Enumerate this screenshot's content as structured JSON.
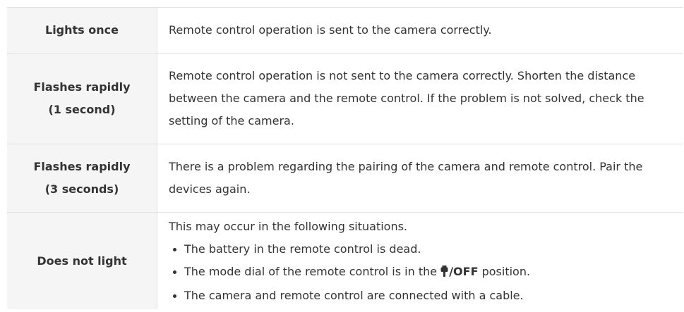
{
  "rows": [
    {
      "status": "Lights once",
      "description": "Remote control operation is sent to the camera correctly."
    },
    {
      "status": "Flashes rapidly (1 second)",
      "status_line1": "Flashes rapidly",
      "status_line2": "(1 second)",
      "description": "Remote control operation is not sent to the camera correctly. Shorten the distance between the camera and the remote control. If the problem is not solved, check the setting of the camera."
    },
    {
      "status_line1": "Flashes rapidly",
      "status_line2": "(3 seconds)",
      "description": "There is a problem regarding the pairing of the camera and remote control. Pair the devices again."
    },
    {
      "status": "Does not light",
      "intro": "This may occur in the following situations.",
      "bullets": [
        "The battery in the remote control is dead.",
        "The mode dial of the remote control is in the",
        "The camera and remote control are connected with a cable."
      ],
      "position_suffix": "position.",
      "off_label": "/OFF",
      "icon": "power-switch-icon"
    }
  ]
}
